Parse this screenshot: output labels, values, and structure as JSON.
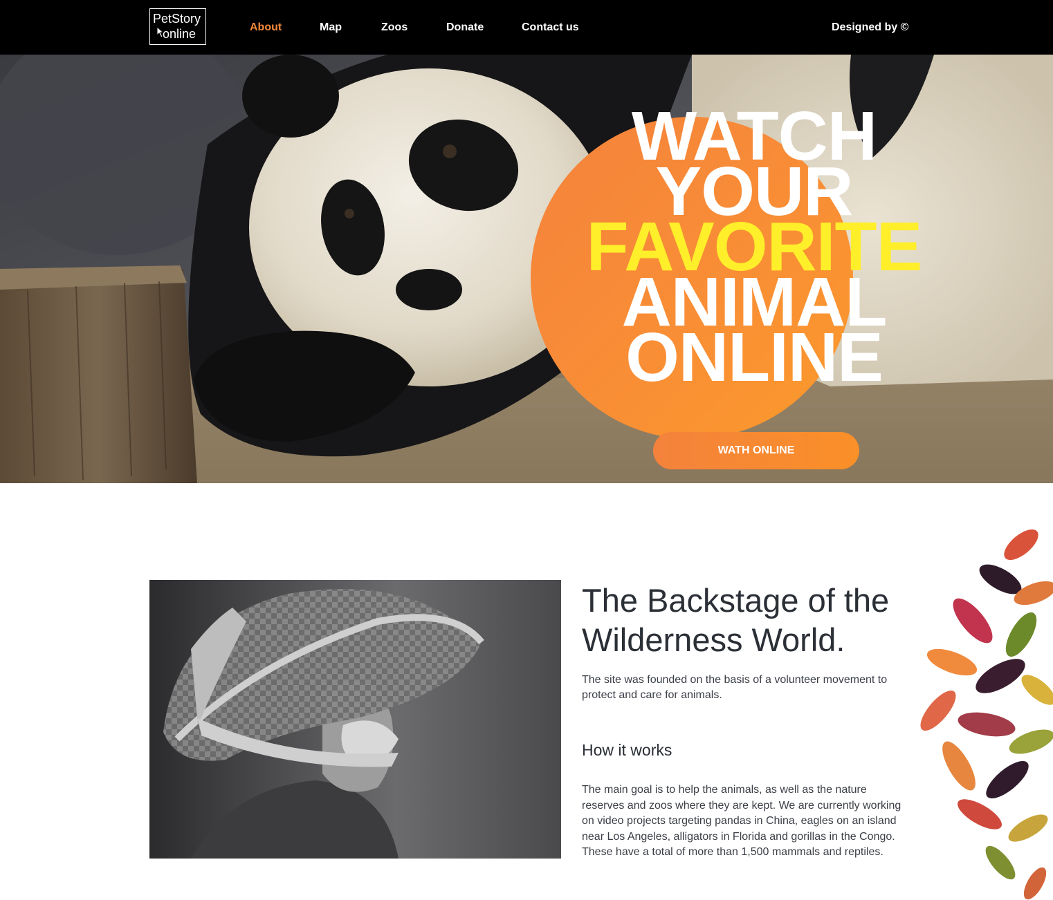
{
  "header": {
    "logo": {
      "line1": "PetStory",
      "line2": "online"
    },
    "nav": [
      {
        "label": "About",
        "active": true
      },
      {
        "label": "Map",
        "active": false
      },
      {
        "label": "Zoos",
        "active": false
      },
      {
        "label": "Donate",
        "active": false
      },
      {
        "label": "Contact us",
        "active": false
      }
    ],
    "credit": "Designed by ©"
  },
  "hero": {
    "title_lines": [
      "WATCH",
      "YOUR",
      "FAVORITE",
      "ANIMAL",
      "ONLINE"
    ],
    "highlight_line": "FAVORITE",
    "button_label": "WATH ONLINE"
  },
  "about": {
    "title": "The Backstage of the Wilderness World.",
    "intro": "The site was founded on the basis of a volunteer movement to protect and care for animals.",
    "how_title": "How it works",
    "how_text": "The main goal is to help the animals, as well as the nature reserves and zoos where they are kept. We are currently working on video projects targeting pandas in China, eagles on an island near Los Angeles, alligators in Florida and gorillas in the Congo. These have a total of more than 1,500 mammals and reptiles."
  },
  "colors": {
    "accent": "#f4893a",
    "highlight": "#ffee2a",
    "header_bg": "#000000",
    "text": "#2b2f36"
  },
  "icons": [
    "mouse-cursor-icon"
  ]
}
